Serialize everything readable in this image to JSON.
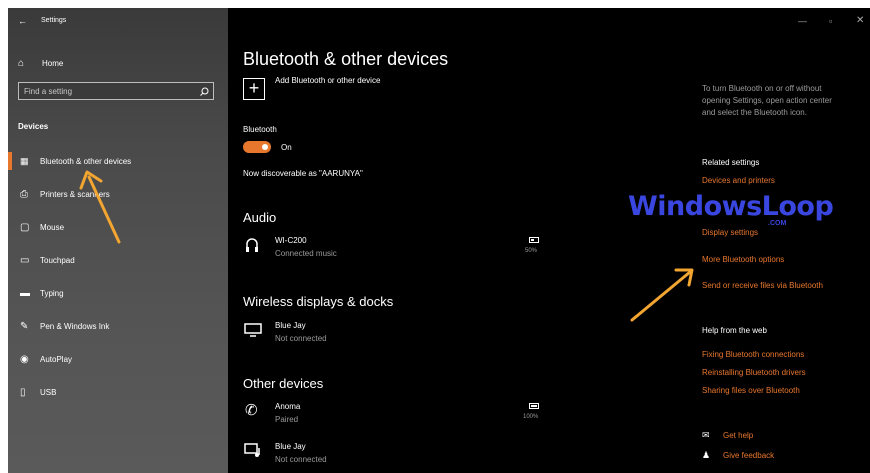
{
  "window": {
    "title": "Settings"
  },
  "sidebar": {
    "home": "Home",
    "search_placeholder": "Find a setting",
    "section": "Devices",
    "items": [
      {
        "label": "Bluetooth & other devices",
        "icon": "bluetooth-devices-icon"
      },
      {
        "label": "Printers & scanners",
        "icon": "printer-icon"
      },
      {
        "label": "Mouse",
        "icon": "mouse-icon"
      },
      {
        "label": "Touchpad",
        "icon": "touchpad-icon"
      },
      {
        "label": "Typing",
        "icon": "keyboard-icon"
      },
      {
        "label": "Pen & Windows Ink",
        "icon": "pen-icon"
      },
      {
        "label": "AutoPlay",
        "icon": "autoplay-icon"
      },
      {
        "label": "USB",
        "icon": "usb-icon"
      }
    ]
  },
  "main": {
    "title": "Bluetooth & other devices",
    "add_device": "Add Bluetooth or other device",
    "bluetooth_label": "Bluetooth",
    "bluetooth_state": "On",
    "discoverable": "Now discoverable as \"AARUNYA\"",
    "audio": {
      "heading": "Audio",
      "device": {
        "name": "WI-C200",
        "status": "Connected music",
        "battery": "50%",
        "battery_level": 0.5
      }
    },
    "wireless": {
      "heading": "Wireless displays & docks",
      "device": {
        "name": "Blue Jay",
        "status": "Not connected"
      }
    },
    "other": {
      "heading": "Other devices",
      "devices": [
        {
          "name": "Anoma",
          "status": "Paired",
          "battery": "100%",
          "battery_level": 1.0
        },
        {
          "name": "Blue Jay",
          "status": "Not connected"
        }
      ]
    }
  },
  "right": {
    "tip": [
      "To turn Bluetooth on or off without",
      "opening Settings, open action center",
      "and select the Bluetooth icon."
    ],
    "related_heading": "Related settings",
    "related": [
      "Devices and printers",
      "Display settings",
      "More Bluetooth options",
      "Send or receive files via Bluetooth"
    ],
    "help_heading": "Help from the web",
    "help_links": [
      "Fixing Bluetooth connections",
      "Reinstalling Bluetooth drivers",
      "Sharing files over Bluetooth"
    ],
    "get_help": "Get help",
    "give_feedback": "Give feedback"
  },
  "watermark": {
    "text": "WindowsLoop",
    "sub": ".COM"
  },
  "colors": {
    "accent": "#e8772e",
    "sidebar": "#4a4a4a",
    "background": "#000000",
    "annotation_arrow": "#f2a531",
    "watermark": "#3a46e0"
  }
}
